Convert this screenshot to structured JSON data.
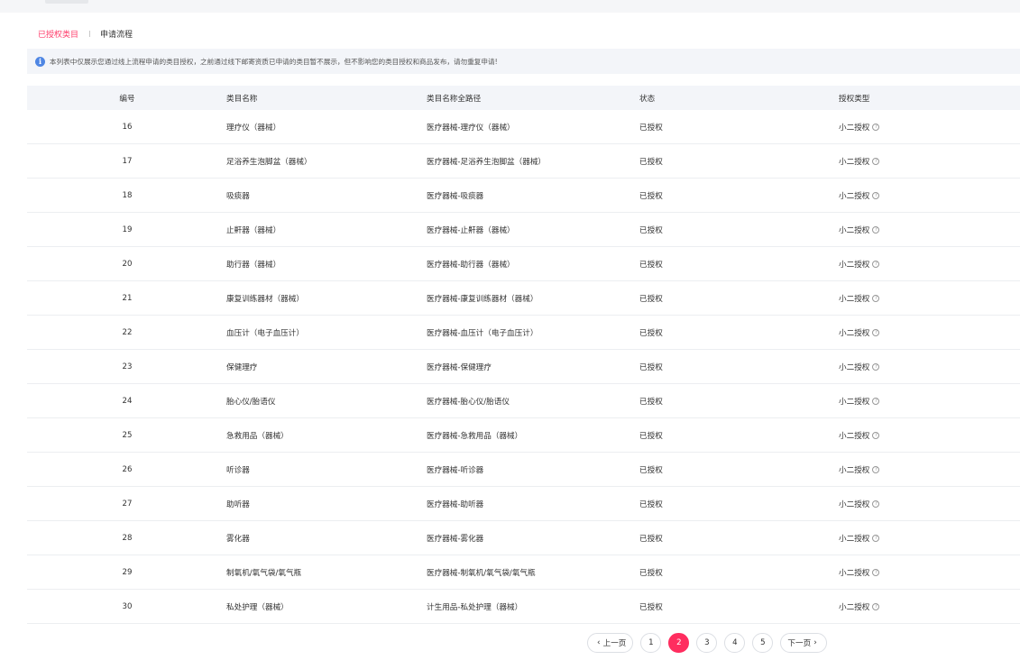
{
  "tabs": [
    {
      "label": "已授权类目",
      "active": true
    },
    {
      "label": "申请流程",
      "active": false
    }
  ],
  "notice": {
    "icon": "info-icon",
    "text": "本列表中仅展示您通过线上流程申请的类目授权，之前通过线下邮寄资质已申请的类目暂不展示，但不影响您的类目授权和商品发布，请勿重复申请!"
  },
  "table": {
    "headers": [
      "编号",
      "类目名称",
      "类目名称全路径",
      "状态",
      "授权类型"
    ],
    "rows": [
      {
        "id": "16",
        "name": "理疗仪（器械）",
        "path": "医疗器械-理疗仪（器械）",
        "status": "已授权",
        "type": "小二授权"
      },
      {
        "id": "17",
        "name": "足浴养生泡脚盆（器械）",
        "path": "医疗器械-足浴养生泡脚盆（器械）",
        "status": "已授权",
        "type": "小二授权"
      },
      {
        "id": "18",
        "name": "吸痰器",
        "path": "医疗器械-吸痰器",
        "status": "已授权",
        "type": "小二授权"
      },
      {
        "id": "19",
        "name": "止鼾器（器械）",
        "path": "医疗器械-止鼾器（器械）",
        "status": "已授权",
        "type": "小二授权"
      },
      {
        "id": "20",
        "name": "助行器（器械）",
        "path": "医疗器械-助行器（器械）",
        "status": "已授权",
        "type": "小二授权"
      },
      {
        "id": "21",
        "name": "康复训练器材（器械）",
        "path": "医疗器械-康复训练器材（器械）",
        "status": "已授权",
        "type": "小二授权"
      },
      {
        "id": "22",
        "name": "血压计（电子血压计）",
        "path": "医疗器械-血压计（电子血压计）",
        "status": "已授权",
        "type": "小二授权"
      },
      {
        "id": "23",
        "name": "保健理疗",
        "path": "医疗器械-保健理疗",
        "status": "已授权",
        "type": "小二授权"
      },
      {
        "id": "24",
        "name": "胎心仪/胎语仪",
        "path": "医疗器械-胎心仪/胎语仪",
        "status": "已授权",
        "type": "小二授权"
      },
      {
        "id": "25",
        "name": "急救用品（器械）",
        "path": "医疗器械-急救用品（器械）",
        "status": "已授权",
        "type": "小二授权"
      },
      {
        "id": "26",
        "name": "听诊器",
        "path": "医疗器械-听诊器",
        "status": "已授权",
        "type": "小二授权"
      },
      {
        "id": "27",
        "name": "助听器",
        "path": "医疗器械-助听器",
        "status": "已授权",
        "type": "小二授权"
      },
      {
        "id": "28",
        "name": "雾化器",
        "path": "医疗器械-雾化器",
        "status": "已授权",
        "type": "小二授权"
      },
      {
        "id": "29",
        "name": "制氧机/氧气袋/氧气瓶",
        "path": "医疗器械-制氧机/氧气袋/氧气瓶",
        "status": "已授权",
        "type": "小二授权"
      },
      {
        "id": "30",
        "name": "私处护理（器械）",
        "path": "计生用品-私处护理（器械）",
        "status": "已授权",
        "type": "小二授权"
      }
    ]
  },
  "pagination": {
    "prev": "上一页",
    "next": "下一页",
    "pages": [
      "1",
      "2",
      "3",
      "4",
      "5"
    ],
    "current": "2"
  },
  "colors": {
    "accent": "#ff2d5f",
    "tab_active": "#ff3d6b",
    "info": "#4f86e3"
  }
}
